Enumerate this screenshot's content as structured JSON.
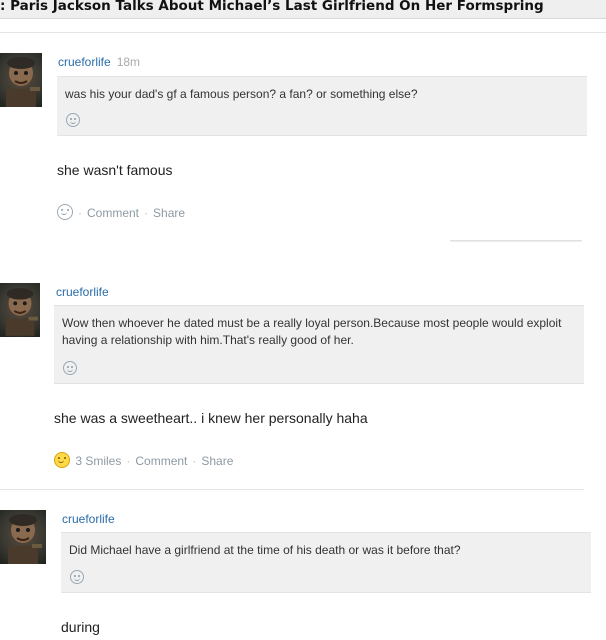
{
  "page": {
    "title": ": Paris Jackson Talks About Michael’s Last Girlfriend On Her Formspring"
  },
  "posts": [
    {
      "username": "crueforlife",
      "time": "18m",
      "question": "was his your dad's gf a famous person? a fan? or something else?",
      "answer": "she wasn't famous",
      "smiles": "",
      "comment_label": "Comment",
      "share_label": "Share"
    },
    {
      "username": "crueforlife",
      "time": "",
      "question": "Wow then whoever he dated must be a really loyal person.Because most people would exploit having a relationship with him.That's really good of her.",
      "answer": "she was a sweetheart.. i knew her personally haha",
      "smiles": "3 Smiles",
      "comment_label": "Comment",
      "share_label": "Share"
    },
    {
      "username": "crueforlife",
      "time": "",
      "question": "Did Michael have a girlfriend at the time of his death or was it before that?",
      "answer": "during",
      "smiles": "",
      "comment_label": "",
      "share_label": ""
    }
  ],
  "colors": {
    "link": "#2a6ca8",
    "muted": "#8d9aa4",
    "question_bg": "#f0f0f0",
    "smile_active": "#ffd94a"
  },
  "icons": [
    "avatar-image",
    "smile-icon",
    "smile-icon-active"
  ]
}
